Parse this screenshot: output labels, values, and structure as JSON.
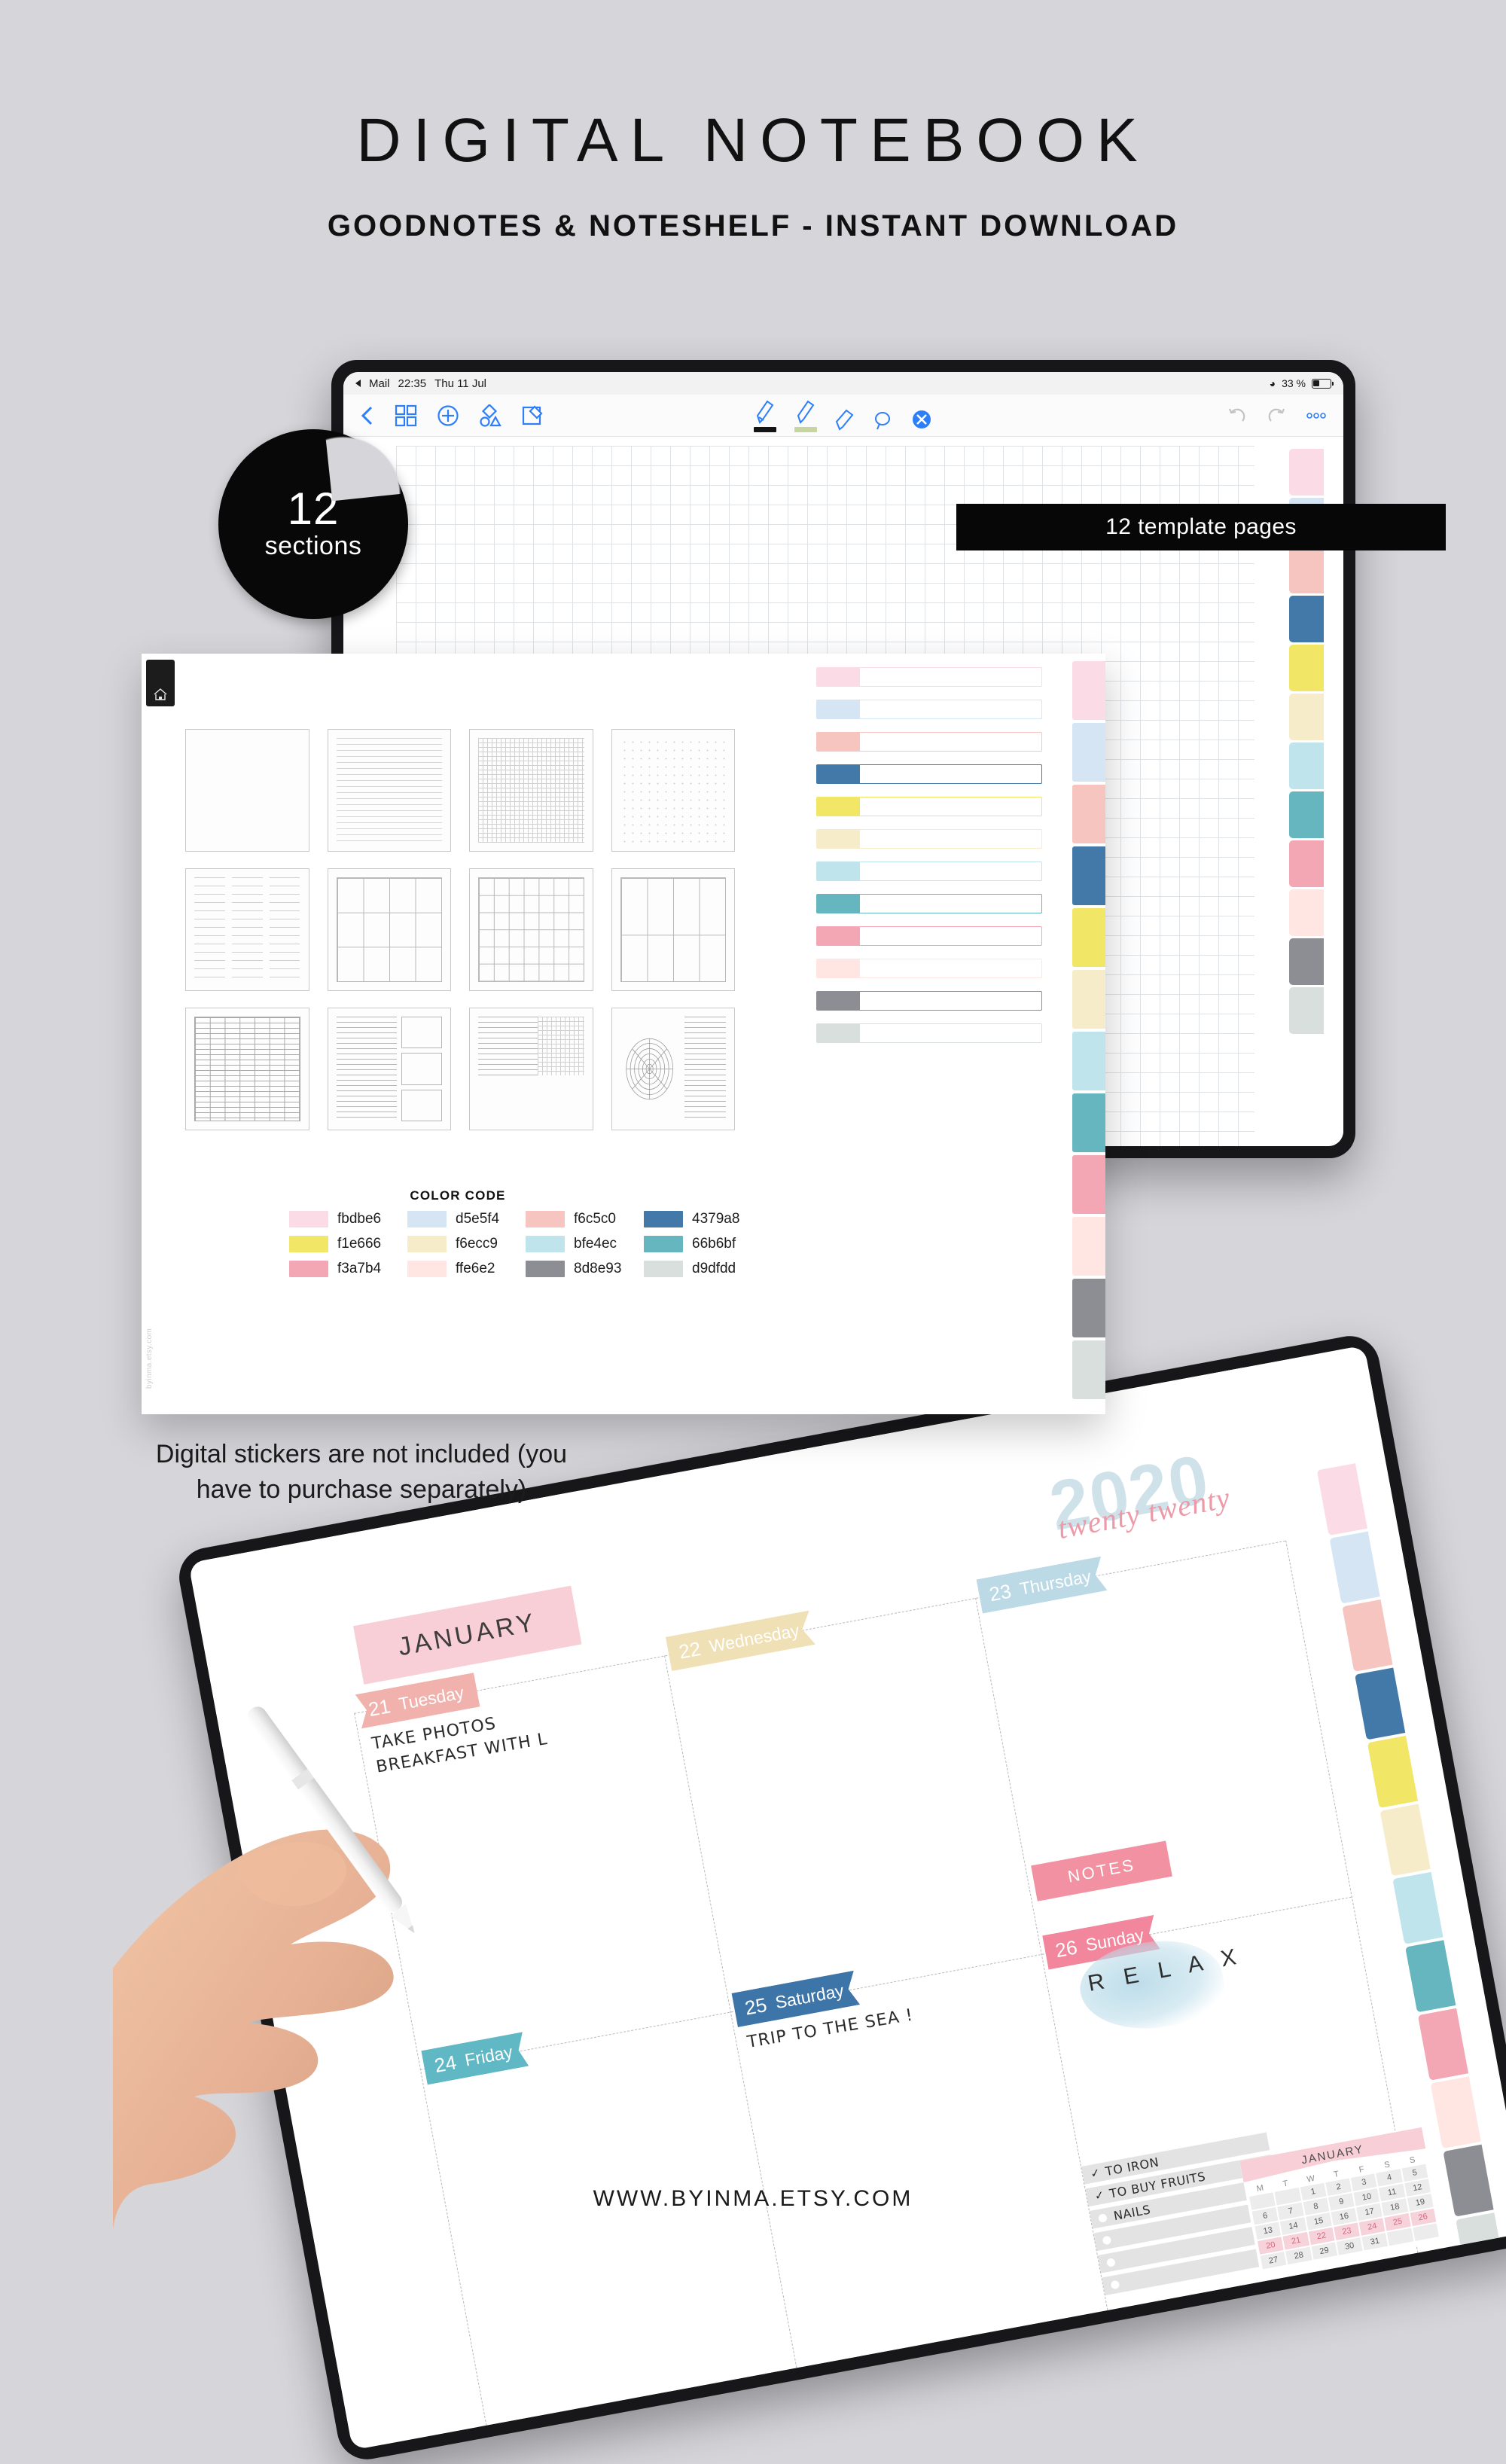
{
  "header": {
    "title": "DIGITAL NOTEBOOK",
    "subtitle": "GOODNOTES & NOTESHELF - INSTANT DOWNLOAD"
  },
  "badge": {
    "number": "12",
    "label": "sections"
  },
  "ribbon": {
    "label": "12 template pages"
  },
  "notice": {
    "text": "Digital stickers are not included (you have to purchase separately)"
  },
  "footer": {
    "url": "WWW.BYINMA.ETSY.COM"
  },
  "status_bar": {
    "back_app": "Mail",
    "time": "22:35",
    "date": "Thu 11 Jul",
    "battery": "33 %",
    "wifi_icon": "wifi-icon",
    "battery_icon": "battery-icon"
  },
  "toolbar": {
    "left_icons": [
      "back-chevron-icon",
      "grid-view-icon",
      "add-page-icon",
      "shapes-icon",
      "compose-icon"
    ],
    "center_tools": [
      "marker-pen-icon",
      "pencil-icon",
      "eraser-icon",
      "lasso-icon",
      "close-icon"
    ],
    "right_icons": [
      "undo-icon",
      "redo-icon",
      "more-options-icon"
    ]
  },
  "index_page": {
    "home_tab_icon": "home-icon",
    "watermark": "byinma.etsy.com",
    "color_code_title": "COLOR CODE",
    "color_code": [
      {
        "hex": "fbdbe6",
        "swatch": "#fbdbe6"
      },
      {
        "hex": "d5e5f4",
        "swatch": "#d5e5f4"
      },
      {
        "hex": "f6c5c0",
        "swatch": "#f6c5c0"
      },
      {
        "hex": "4379a8",
        "swatch": "#4379a8"
      },
      {
        "hex": "f1e666",
        "swatch": "#f1e666"
      },
      {
        "hex": "f6ecc9",
        "swatch": "#f6ecc9"
      },
      {
        "hex": "bfe4ec",
        "swatch": "#bfe4ec"
      },
      {
        "hex": "66b6bf",
        "swatch": "#66b6bf"
      },
      {
        "hex": "f3a7b4",
        "swatch": "#f3a7b4"
      },
      {
        "hex": "ffe6e2",
        "swatch": "#ffe6e2"
      },
      {
        "hex": "8d8e93",
        "swatch": "#8d8e93"
      },
      {
        "hex": "d9dfdd",
        "swatch": "#d9dfdd"
      }
    ],
    "templates": [
      {
        "name": "blank-page",
        "pattern": "blank"
      },
      {
        "name": "lined-page",
        "pattern": "lined"
      },
      {
        "name": "grid-page",
        "pattern": "grid"
      },
      {
        "name": "dotted-page",
        "pattern": "dotted"
      },
      {
        "name": "three-column-lined-page",
        "pattern": "cols3-lined"
      },
      {
        "name": "four-by-three-box-page",
        "pattern": "boxes"
      },
      {
        "name": "monthly-grid-page",
        "pattern": "month"
      },
      {
        "name": "four-column-page",
        "pattern": "cols4"
      },
      {
        "name": "dense-table-page",
        "pattern": "table"
      },
      {
        "name": "mixed-layout-page",
        "pattern": "mixed"
      },
      {
        "name": "half-grid-page",
        "pattern": "halfgrid"
      },
      {
        "name": "habit-tracker-page",
        "pattern": "tracker"
      }
    ],
    "section_tabs": [
      "#fbdbe6",
      "#d5e5f4",
      "#f6c5c0",
      "#4379a8",
      "#f1e666",
      "#f6ecc9",
      "#bfe4ec",
      "#66b6bf",
      "#f3a7b4",
      "#ffe6e2",
      "#8d8e93",
      "#d9dfdd"
    ]
  },
  "weekly_page": {
    "year_number": "2020",
    "year_script": "twenty twenty",
    "month": "JANUARY",
    "notes_label": "NOTES",
    "relax_text": "R E L A X",
    "days": [
      {
        "num": "21",
        "name": "Tuesday",
        "color": "#f1b2ad",
        "entries": [
          "TAKE PHOTOS",
          "BREAKFAST WITH L"
        ]
      },
      {
        "num": "22",
        "name": "Wednesday",
        "color": "#f0e0b6",
        "entries": []
      },
      {
        "num": "23",
        "name": "Thursday",
        "color": "#bcd9e6",
        "entries": []
      },
      {
        "num": "24",
        "name": "Friday",
        "color": "#5fb8c4",
        "entries": []
      },
      {
        "num": "25",
        "name": "Saturday",
        "color": "#3d75a8",
        "entries": [
          "TRIP TO THE SEA !"
        ]
      },
      {
        "num": "26",
        "name": "Sunday",
        "color": "#f1869c",
        "entries": []
      }
    ],
    "todo": [
      {
        "text": "TO IRON",
        "checked": true
      },
      {
        "text": "TO BUY FRUITS",
        "checked": true
      },
      {
        "text": "NAILS",
        "checked": false
      },
      {
        "text": "",
        "checked": false
      },
      {
        "text": "",
        "checked": false
      },
      {
        "text": "",
        "checked": false
      }
    ],
    "mini_calendar": {
      "month": "JANUARY",
      "weekday_headers": [
        "M",
        "T",
        "W",
        "T",
        "F",
        "S",
        "S"
      ],
      "weeks": [
        [
          "",
          "",
          "1",
          "2",
          "3",
          "4",
          "5"
        ],
        [
          "6",
          "7",
          "8",
          "9",
          "10",
          "11",
          "12"
        ],
        [
          "13",
          "14",
          "15",
          "16",
          "17",
          "18",
          "19"
        ],
        [
          "20",
          "21",
          "22",
          "23",
          "24",
          "25",
          "26"
        ],
        [
          "27",
          "28",
          "29",
          "30",
          "31",
          "",
          ""
        ]
      ],
      "highlighted_week": 3
    },
    "section_tabs": [
      "#fbdbe6",
      "#d5e5f4",
      "#f6c5c0",
      "#4379a8",
      "#f1e666",
      "#f6ecc9",
      "#bfe4ec",
      "#66b6bf",
      "#f3a7b4",
      "#ffe6e2",
      "#8d8e93",
      "#d9dfdd"
    ]
  }
}
